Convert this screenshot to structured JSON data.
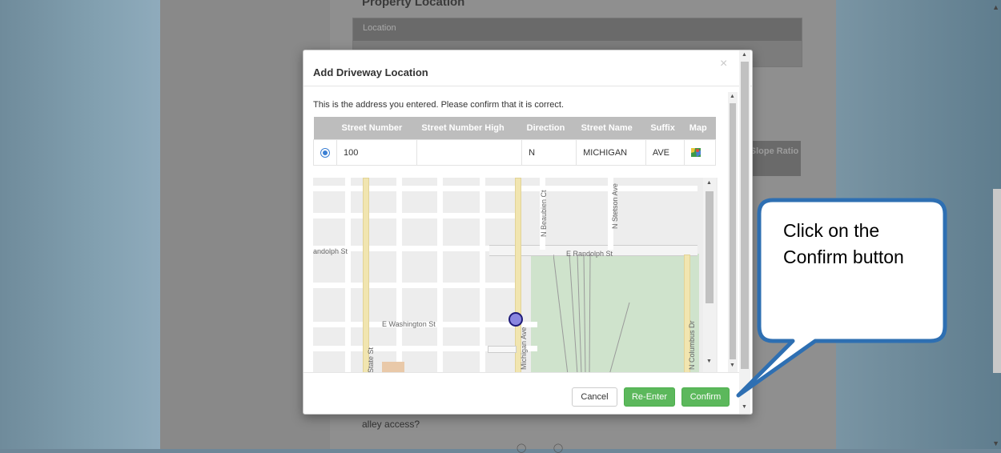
{
  "background": {
    "heading": "Property Location",
    "table_header": "Location",
    "slope_label": "Slope Ratio",
    "alley_question": "alley access?"
  },
  "modal": {
    "title": "Add Driveway Location",
    "close_symbol": "×",
    "confirm_text": "This is the address you entered. Please confirm that it is correct.",
    "table": {
      "headers": [
        "Street Number",
        "Street Number High",
        "Direction",
        "Street Name",
        "Suffix",
        "Map"
      ],
      "rows": [
        {
          "selected": true,
          "street_number": "100",
          "street_number_high": "",
          "direction": "N",
          "street_name": "MICHIGAN",
          "suffix": "AVE",
          "map_icon": "map-icon"
        }
      ]
    },
    "map": {
      "labels": {
        "randolph_w": "andolph St",
        "randolph_e": "E Randolph St",
        "washington": "E Washington St",
        "beaubien": "N Beaubien Ct",
        "stetson": "N Stetson Ave",
        "michigan": "Michigan Ave",
        "state": "State St",
        "columbus": "N Columbus Dr"
      },
      "marker_color": "#8a86e0"
    },
    "buttons": {
      "cancel": "Cancel",
      "reenter": "Re-Enter",
      "confirm": "Confirm"
    }
  },
  "callout": {
    "text": "Click on the Confirm button",
    "border_color": "#2e6fb2"
  }
}
